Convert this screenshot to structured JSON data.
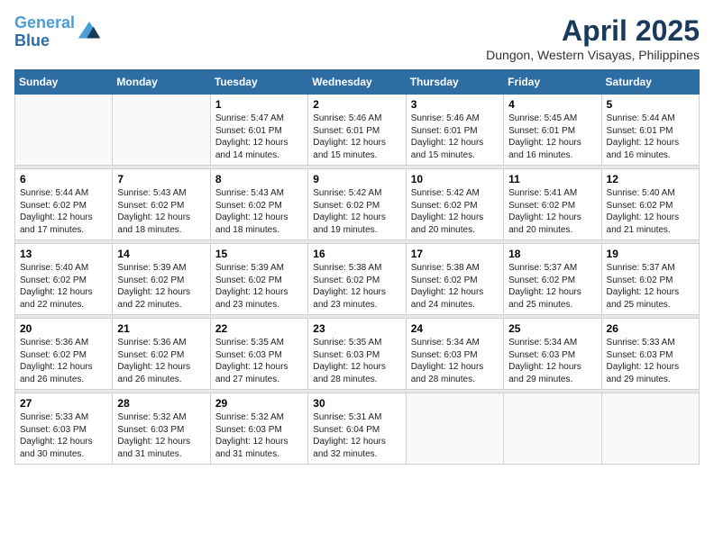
{
  "header": {
    "logo_line1": "General",
    "logo_line2": "Blue",
    "month_title": "April 2025",
    "location": "Dungon, Western Visayas, Philippines"
  },
  "weekdays": [
    "Sunday",
    "Monday",
    "Tuesday",
    "Wednesday",
    "Thursday",
    "Friday",
    "Saturday"
  ],
  "weeks": [
    [
      {
        "day": "",
        "info": ""
      },
      {
        "day": "",
        "info": ""
      },
      {
        "day": "1",
        "info": "Sunrise: 5:47 AM\nSunset: 6:01 PM\nDaylight: 12 hours and 14 minutes."
      },
      {
        "day": "2",
        "info": "Sunrise: 5:46 AM\nSunset: 6:01 PM\nDaylight: 12 hours and 15 minutes."
      },
      {
        "day": "3",
        "info": "Sunrise: 5:46 AM\nSunset: 6:01 PM\nDaylight: 12 hours and 15 minutes."
      },
      {
        "day": "4",
        "info": "Sunrise: 5:45 AM\nSunset: 6:01 PM\nDaylight: 12 hours and 16 minutes."
      },
      {
        "day": "5",
        "info": "Sunrise: 5:44 AM\nSunset: 6:01 PM\nDaylight: 12 hours and 16 minutes."
      }
    ],
    [
      {
        "day": "6",
        "info": "Sunrise: 5:44 AM\nSunset: 6:02 PM\nDaylight: 12 hours and 17 minutes."
      },
      {
        "day": "7",
        "info": "Sunrise: 5:43 AM\nSunset: 6:02 PM\nDaylight: 12 hours and 18 minutes."
      },
      {
        "day": "8",
        "info": "Sunrise: 5:43 AM\nSunset: 6:02 PM\nDaylight: 12 hours and 18 minutes."
      },
      {
        "day": "9",
        "info": "Sunrise: 5:42 AM\nSunset: 6:02 PM\nDaylight: 12 hours and 19 minutes."
      },
      {
        "day": "10",
        "info": "Sunrise: 5:42 AM\nSunset: 6:02 PM\nDaylight: 12 hours and 20 minutes."
      },
      {
        "day": "11",
        "info": "Sunrise: 5:41 AM\nSunset: 6:02 PM\nDaylight: 12 hours and 20 minutes."
      },
      {
        "day": "12",
        "info": "Sunrise: 5:40 AM\nSunset: 6:02 PM\nDaylight: 12 hours and 21 minutes."
      }
    ],
    [
      {
        "day": "13",
        "info": "Sunrise: 5:40 AM\nSunset: 6:02 PM\nDaylight: 12 hours and 22 minutes."
      },
      {
        "day": "14",
        "info": "Sunrise: 5:39 AM\nSunset: 6:02 PM\nDaylight: 12 hours and 22 minutes."
      },
      {
        "day": "15",
        "info": "Sunrise: 5:39 AM\nSunset: 6:02 PM\nDaylight: 12 hours and 23 minutes."
      },
      {
        "day": "16",
        "info": "Sunrise: 5:38 AM\nSunset: 6:02 PM\nDaylight: 12 hours and 23 minutes."
      },
      {
        "day": "17",
        "info": "Sunrise: 5:38 AM\nSunset: 6:02 PM\nDaylight: 12 hours and 24 minutes."
      },
      {
        "day": "18",
        "info": "Sunrise: 5:37 AM\nSunset: 6:02 PM\nDaylight: 12 hours and 25 minutes."
      },
      {
        "day": "19",
        "info": "Sunrise: 5:37 AM\nSunset: 6:02 PM\nDaylight: 12 hours and 25 minutes."
      }
    ],
    [
      {
        "day": "20",
        "info": "Sunrise: 5:36 AM\nSunset: 6:02 PM\nDaylight: 12 hours and 26 minutes."
      },
      {
        "day": "21",
        "info": "Sunrise: 5:36 AM\nSunset: 6:02 PM\nDaylight: 12 hours and 26 minutes."
      },
      {
        "day": "22",
        "info": "Sunrise: 5:35 AM\nSunset: 6:03 PM\nDaylight: 12 hours and 27 minutes."
      },
      {
        "day": "23",
        "info": "Sunrise: 5:35 AM\nSunset: 6:03 PM\nDaylight: 12 hours and 28 minutes."
      },
      {
        "day": "24",
        "info": "Sunrise: 5:34 AM\nSunset: 6:03 PM\nDaylight: 12 hours and 28 minutes."
      },
      {
        "day": "25",
        "info": "Sunrise: 5:34 AM\nSunset: 6:03 PM\nDaylight: 12 hours and 29 minutes."
      },
      {
        "day": "26",
        "info": "Sunrise: 5:33 AM\nSunset: 6:03 PM\nDaylight: 12 hours and 29 minutes."
      }
    ],
    [
      {
        "day": "27",
        "info": "Sunrise: 5:33 AM\nSunset: 6:03 PM\nDaylight: 12 hours and 30 minutes."
      },
      {
        "day": "28",
        "info": "Sunrise: 5:32 AM\nSunset: 6:03 PM\nDaylight: 12 hours and 31 minutes."
      },
      {
        "day": "29",
        "info": "Sunrise: 5:32 AM\nSunset: 6:03 PM\nDaylight: 12 hours and 31 minutes."
      },
      {
        "day": "30",
        "info": "Sunrise: 5:31 AM\nSunset: 6:04 PM\nDaylight: 12 hours and 32 minutes."
      },
      {
        "day": "",
        "info": ""
      },
      {
        "day": "",
        "info": ""
      },
      {
        "day": "",
        "info": ""
      }
    ]
  ]
}
